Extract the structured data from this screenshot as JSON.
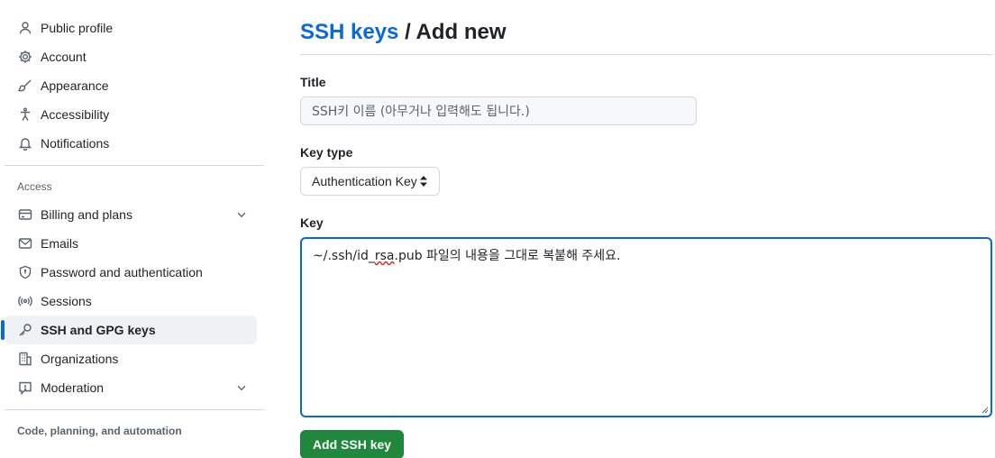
{
  "sidebar": {
    "items": [
      {
        "label": "Public profile",
        "icon": "person-icon"
      },
      {
        "label": "Account",
        "icon": "gear-icon"
      },
      {
        "label": "Appearance",
        "icon": "paintbrush-icon"
      },
      {
        "label": "Accessibility",
        "icon": "accessibility-icon"
      },
      {
        "label": "Notifications",
        "icon": "bell-icon"
      }
    ],
    "access_header": "Access",
    "access_items": [
      {
        "label": "Billing and plans",
        "icon": "credit-card-icon"
      },
      {
        "label": "Emails",
        "icon": "mail-icon"
      },
      {
        "label": "Password and authentication",
        "icon": "shield-lock-icon"
      },
      {
        "label": "Sessions",
        "icon": "broadcast-icon"
      },
      {
        "label": "SSH and GPG keys",
        "icon": "key-icon",
        "active": true
      },
      {
        "label": "Organizations",
        "icon": "organization-icon"
      },
      {
        "label": "Moderation",
        "icon": "report-icon"
      }
    ],
    "code_header": "Code, planning, and automation"
  },
  "main": {
    "breadcrumb_link": "SSH keys",
    "breadcrumb_sep": " / ",
    "title": "Add new",
    "title_label": "Title",
    "title_value": "SSH키 이름 (아무거나 입력해도 됩니다.)",
    "key_type_label": "Key type",
    "key_type_value": "Authentication Key",
    "key_label": "Key",
    "key_value_prefix": "~/.ssh/id_",
    "key_value_misspelled": "rsa",
    "key_value_suffix": ".pub 파일의 내용을 그대로 복붙해 주세요.",
    "submit_label": "Add SSH key"
  },
  "colors": {
    "accent": "#0969da",
    "primary_button": "#1f883d"
  }
}
